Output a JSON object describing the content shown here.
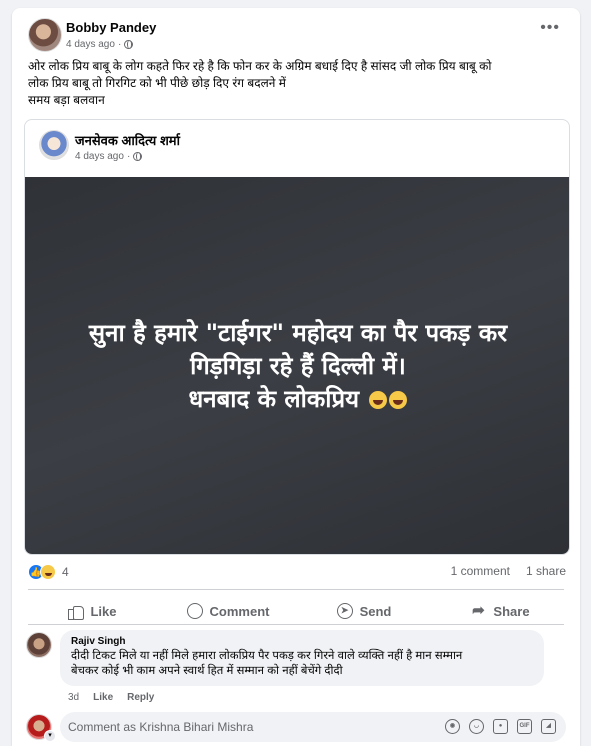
{
  "post": {
    "author": "Bobby Pandey",
    "time": "4 days ago",
    "text": "ओर लोक प्रिय बाबू के लोग कहते फिर रहे है कि फोन कर के अग्रिम बधाई दिए है  सांसद जी लोक प्रिय बाबू को\nलोक प्रिय बाबू तो गिरगिट को भी पीछे छोड़ दिए रंग बदलने में\nसमय बड़ा बलवान",
    "more": "•••"
  },
  "shared": {
    "author": "जनसेवक आदित्य शर्मा",
    "time": "4 days ago",
    "image_text": "सुना है हमारे \"टाईगर\" महोदय का पैर पकड़ कर\nगिड़गिड़ा रहे हैं दिल्ली में।\nधनबाद के लोकप्रिय "
  },
  "stats": {
    "reaction_count": "4",
    "comments": "1 comment",
    "shares": "1 share"
  },
  "actions": {
    "like": "Like",
    "comment": "Comment",
    "send": "Send",
    "share": "Share"
  },
  "comment": {
    "author": "Rajiv Singh",
    "text": "दीदी टिकट मिले या नहीं मिले हमारा लोकप्रिय पैर पकड़ कर गिरने वाले व्यक्ति नहीं है मान सम्मान\nबेचकर कोई भी काम अपने स्वार्थ हित में सम्मान को नहीं बेचेंगे दीदी",
    "age": "3d",
    "like": "Like",
    "reply": "Reply"
  },
  "composer": {
    "placeholder": "Comment as Krishna Bihari Mishra",
    "gif": "GIF"
  },
  "colors": {
    "accent": "#1877f2",
    "secondary_text": "#65676b",
    "image_bg": "#33363b"
  }
}
